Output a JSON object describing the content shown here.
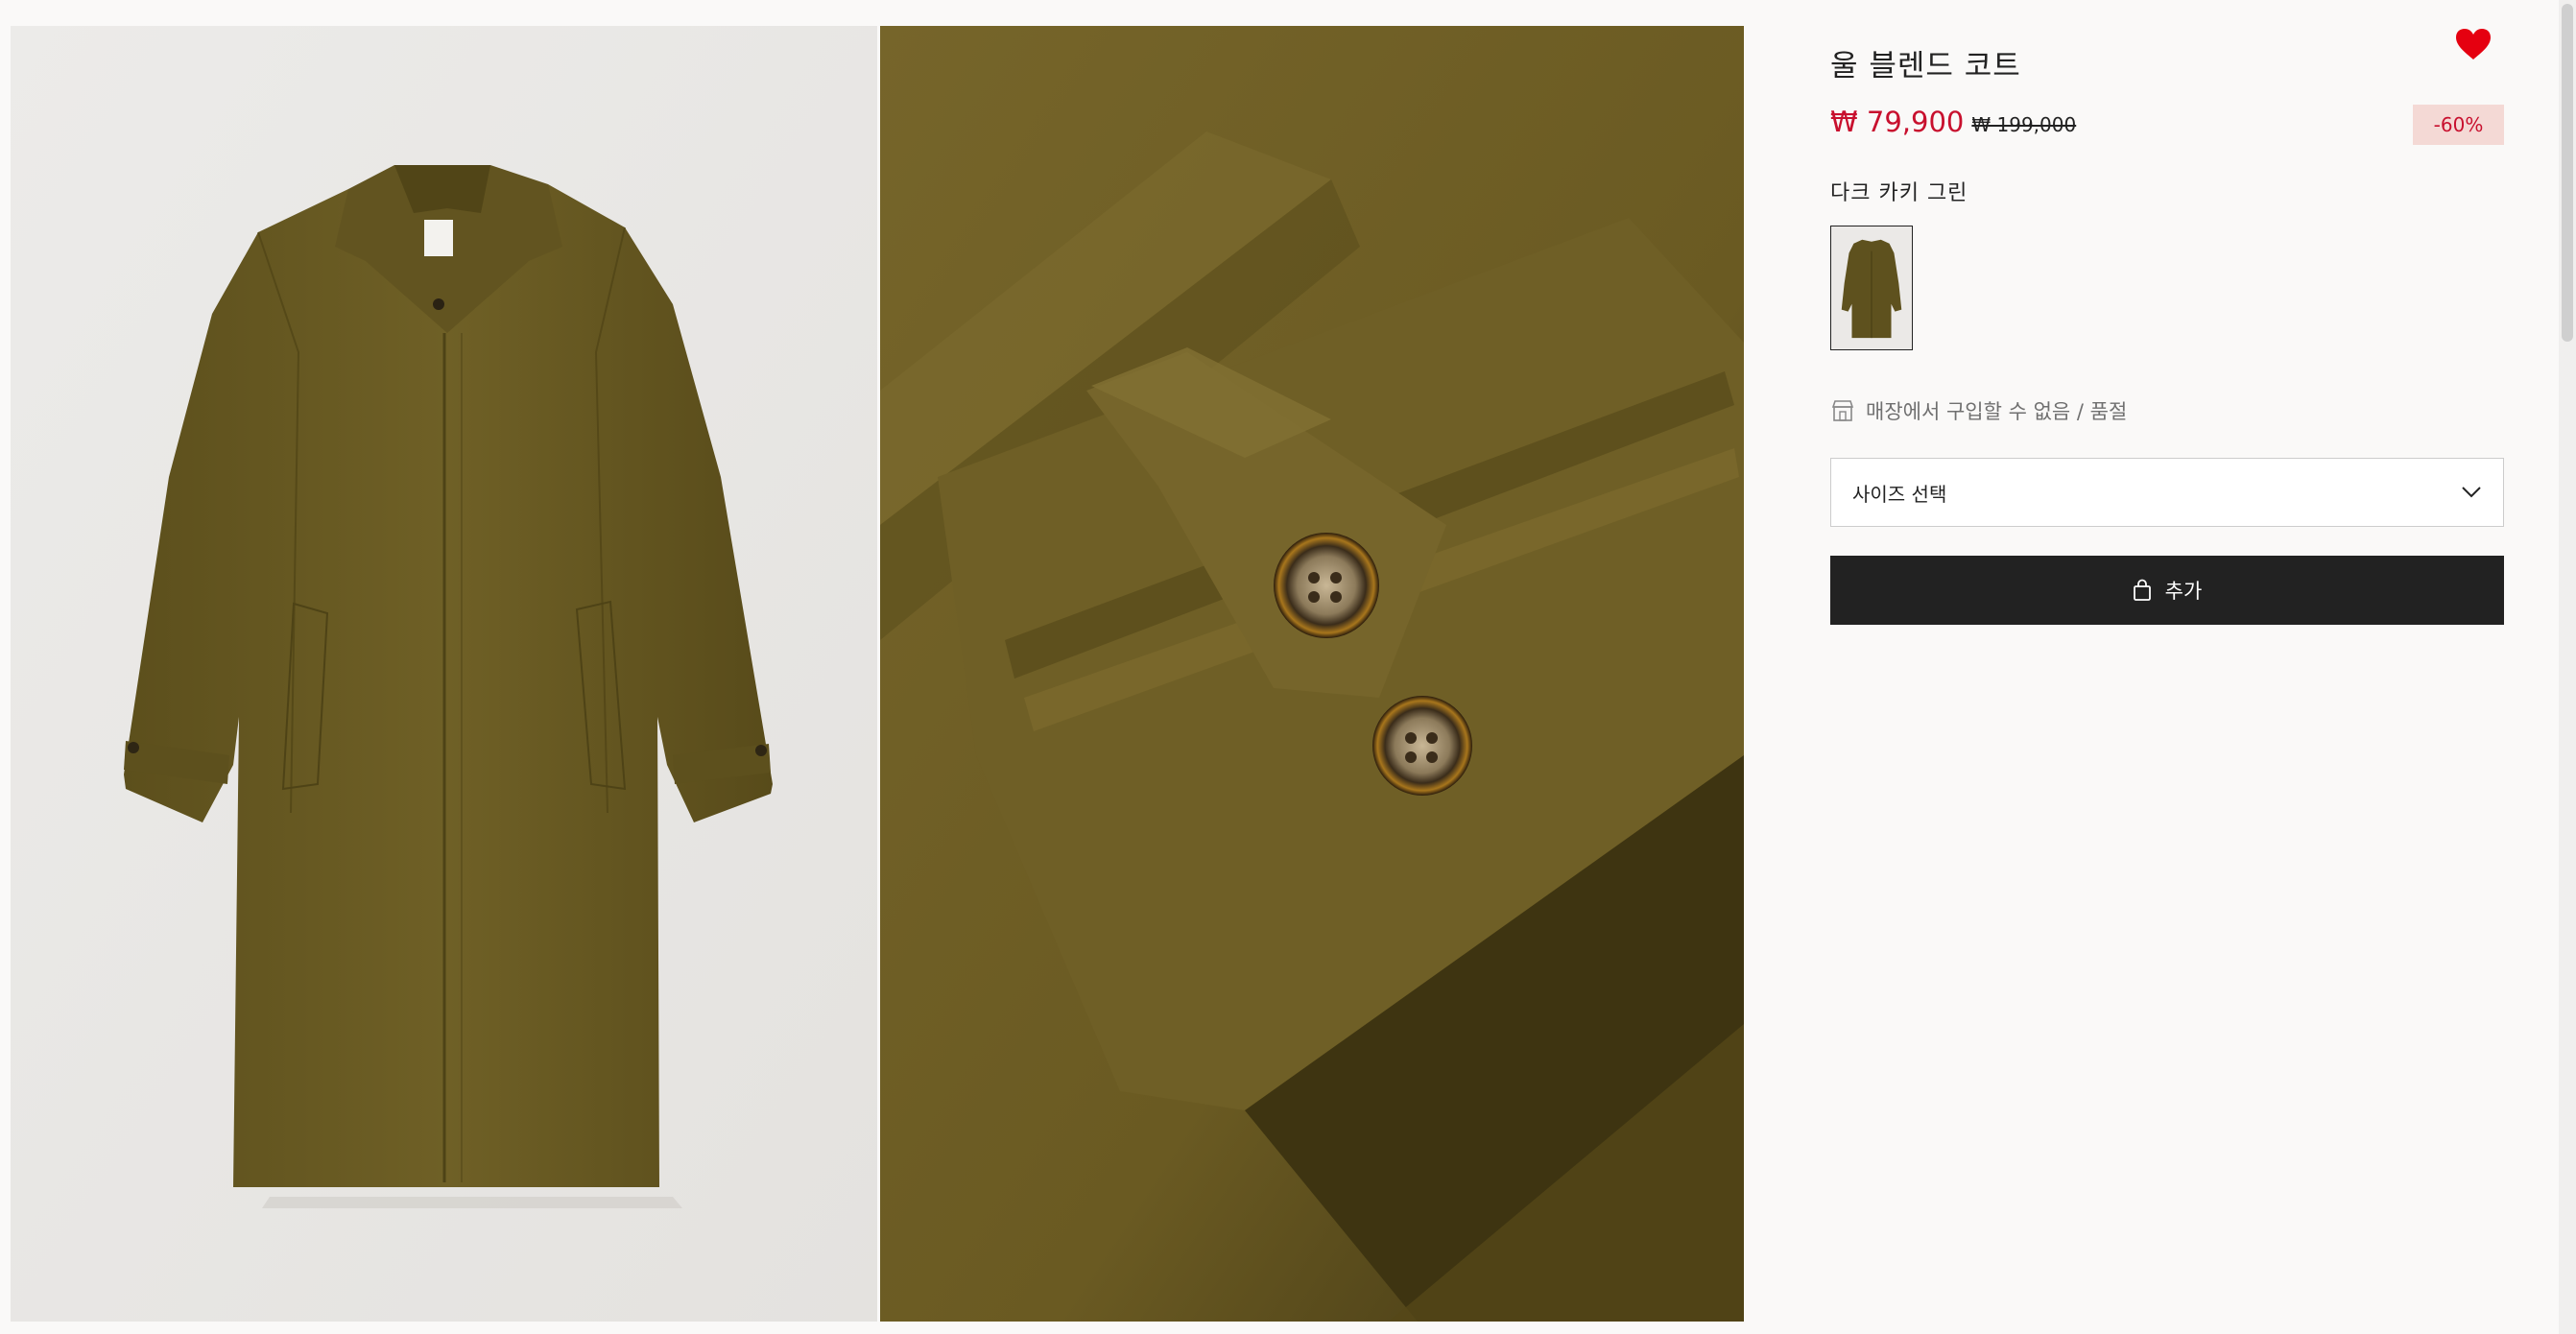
{
  "product": {
    "title": "울 블렌드 코트",
    "price_sale": "₩ 79,900",
    "price_original": "₩ 199,000",
    "discount": "-60%",
    "color_name": "다크 카키 그린",
    "store_availability": "매장에서 구입할 수 없음 / 품절"
  },
  "size_select": {
    "label": "사이즈 선택"
  },
  "add_button": {
    "label": "추가"
  },
  "icons": {
    "favorite": "heart-icon",
    "store": "store-icon",
    "dropdown": "chevron-down-icon",
    "bag": "shopping-bag-icon"
  },
  "colors": {
    "sale": "#c8102e",
    "discount_bg": "#f4d9d5",
    "button_bg": "#222222",
    "favorite": "#e50010",
    "coat": "#6e5f24"
  }
}
